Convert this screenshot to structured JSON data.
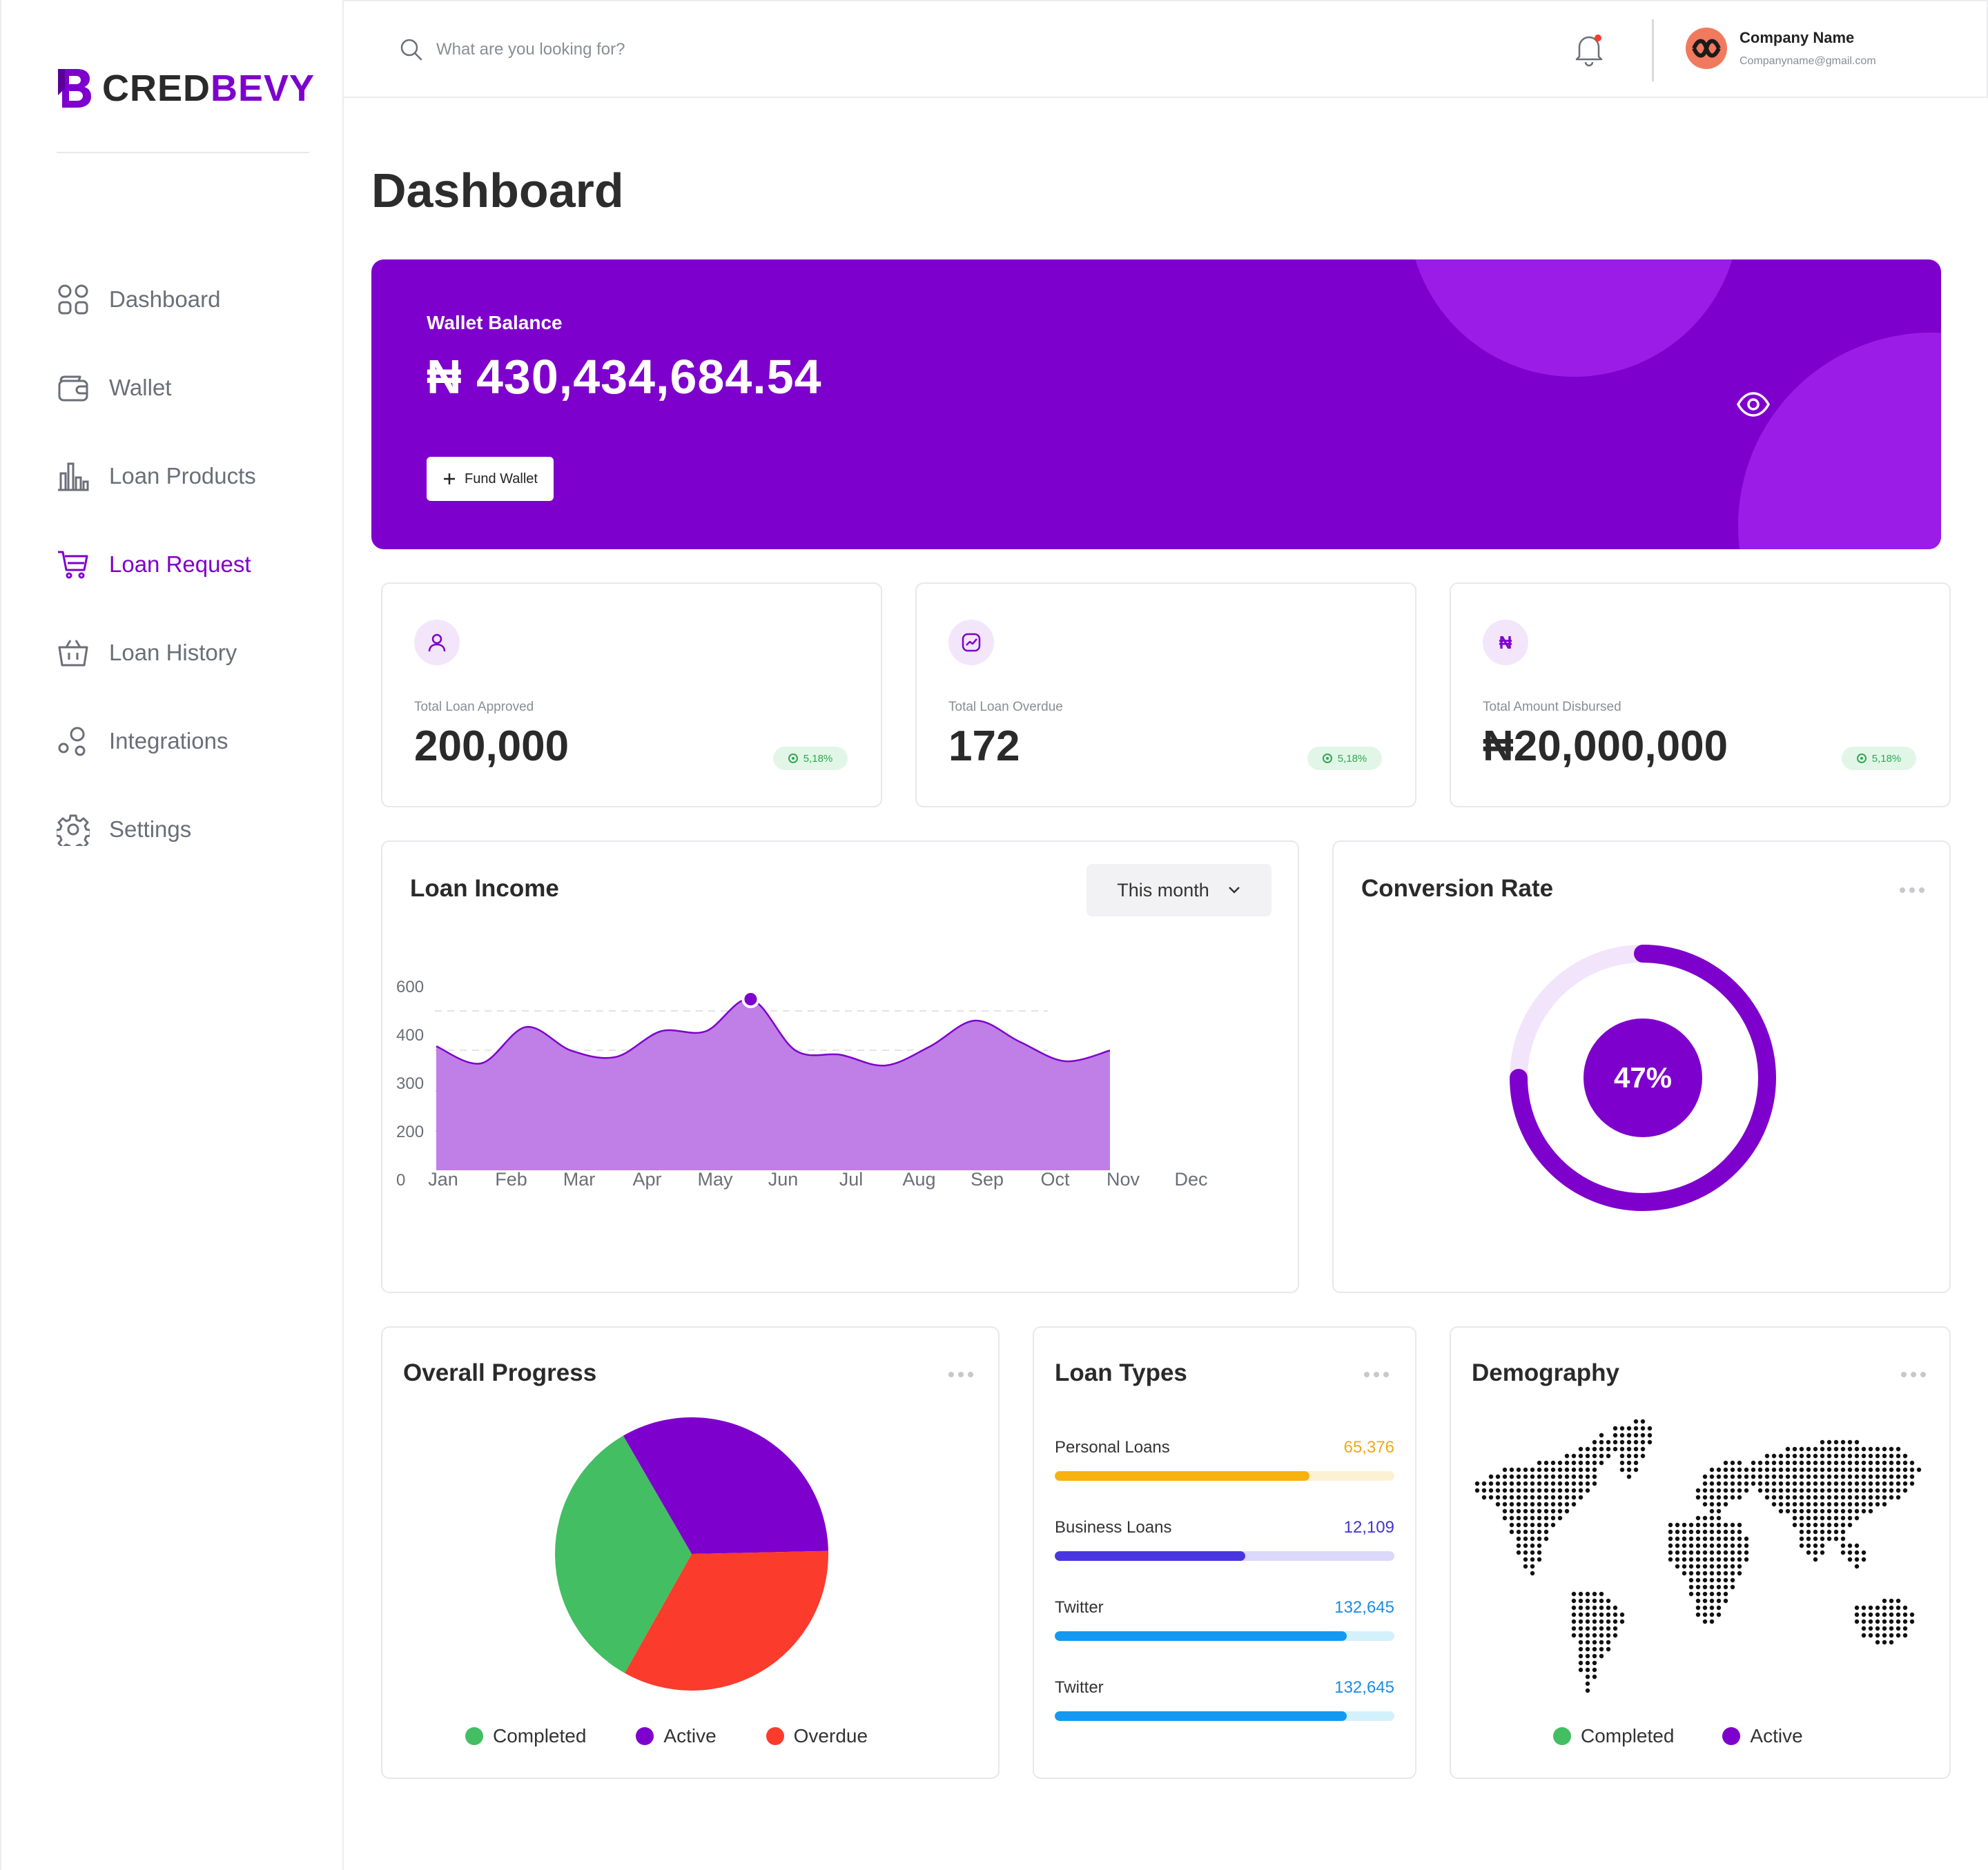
{
  "brand": {
    "name_part1": "CRED",
    "name_part2": "BEVY"
  },
  "sidebar": {
    "items": [
      {
        "label": "Dashboard",
        "icon": "grid-icon"
      },
      {
        "label": "Wallet",
        "icon": "wallet-icon"
      },
      {
        "label": "Loan Products",
        "icon": "bar-chart-icon"
      },
      {
        "label": "Loan Request",
        "icon": "cart-icon",
        "active": true
      },
      {
        "label": "Loan History",
        "icon": "basket-icon"
      },
      {
        "label": "Integrations",
        "icon": "integrations-icon"
      },
      {
        "label": "Settings",
        "icon": "gear-icon"
      }
    ]
  },
  "header": {
    "search_placeholder": "What are you looking for?",
    "company_name": "Company Name",
    "company_email": "Companyname@gmail.com"
  },
  "page_title": "Dashboard",
  "wallet": {
    "label": "Wallet Balance",
    "amount": "₦ 430,434,684.54",
    "fund_label": "Fund Wallet"
  },
  "stats": [
    {
      "label": "Total Loan Approved",
      "value": "200,000",
      "badge": "5,18%",
      "icon": "user-icon"
    },
    {
      "label": "Total Loan Overdue",
      "value": "172",
      "badge": "5,18%",
      "icon": "trend-icon"
    },
    {
      "label": "Total Amount Disbursed",
      "value": "₦20,000,000",
      "badge": "5,18%",
      "icon": "naira-icon",
      "icon_glyph": "₦"
    }
  ],
  "loan_income": {
    "title": "Loan Income",
    "period": "This month"
  },
  "conversion": {
    "title": "Conversion Rate",
    "value_label": "47%"
  },
  "overall_progress": {
    "title": "Overall Progress",
    "legend": [
      "Completed",
      "Active",
      "Overdue"
    ]
  },
  "loan_types": {
    "title": "Loan Types",
    "rows": [
      {
        "label": "Personal Loans",
        "value": "65,376",
        "fraction": 0.75,
        "color": "#f7b20f",
        "track": "#fcf1d2",
        "text_color": "#f0a81d"
      },
      {
        "label": "Business Loans",
        "value": "12,109",
        "fraction": 0.56,
        "color": "#4a36e0",
        "track": "#dcd8fa",
        "text_color": "#3d35d1"
      },
      {
        "label": "Twitter",
        "value": "132,645",
        "fraction": 0.86,
        "color": "#139af0",
        "track": "#d3f1fb",
        "text_color": "#1a8ce6"
      },
      {
        "label": "Twitter",
        "value": "132,645",
        "fraction": 0.86,
        "color": "#139af0",
        "track": "#d3f1fb",
        "text_color": "#1a8ce6"
      }
    ]
  },
  "demography": {
    "title": "Demography",
    "legend": [
      "Completed",
      "Active"
    ]
  },
  "colors": {
    "accent": "#7e00cc",
    "completed": "#43be63",
    "active": "#7e00cc",
    "overdue": "#fb3b2c"
  },
  "chart_data": [
    {
      "type": "area",
      "title": "Loan Income",
      "categories": [
        "Jan",
        "Feb",
        "Mar",
        "Apr",
        "May",
        "Jun",
        "Jul",
        "Aug",
        "Sep",
        "Oct",
        "Nov",
        "Dec"
      ],
      "y_ticks": [
        "600",
        "400",
        "300",
        "200",
        "0"
      ],
      "series": [
        {
          "values": [
            290,
            250,
            335,
            280,
            265,
            325,
            325,
            400,
            280,
            270,
            245,
            290,
            350,
            300,
            255,
            280
          ]
        }
      ],
      "highlight": {
        "x": "Jun",
        "y": 395
      }
    },
    {
      "type": "pie",
      "title": "Conversion Rate",
      "values": [
        47
      ],
      "label": "47%"
    },
    {
      "type": "pie",
      "title": "Overall Progress",
      "categories": [
        "Completed",
        "Active",
        "Overdue"
      ],
      "values": [
        33.5,
        33.0,
        33.5
      ]
    }
  ]
}
